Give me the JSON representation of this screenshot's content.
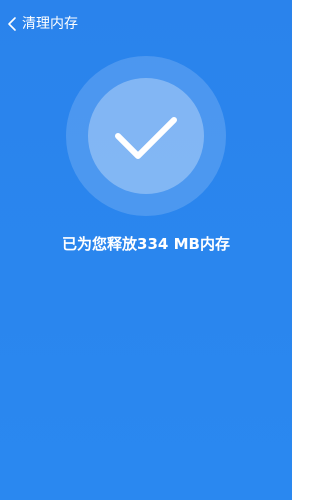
{
  "header": {
    "back_icon": "chevron-left-icon",
    "title": "清理内存"
  },
  "status": {
    "icon": "checkmark-icon",
    "message": "已为您释放334 MB内存"
  },
  "colors": {
    "background": "#2a86ee",
    "text": "#ffffff"
  }
}
